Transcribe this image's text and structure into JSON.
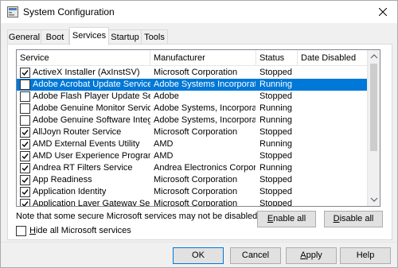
{
  "window": {
    "title": "System Configuration",
    "close_icon": "close-icon",
    "app_icon": "system-config-icon"
  },
  "tabs": [
    {
      "label": "General",
      "active": false
    },
    {
      "label": "Boot",
      "active": false
    },
    {
      "label": "Services",
      "active": true
    },
    {
      "label": "Startup",
      "active": false
    },
    {
      "label": "Tools",
      "active": false
    }
  ],
  "list": {
    "columns": [
      "Service",
      "Manufacturer",
      "Status",
      "Date Disabled"
    ],
    "rows": [
      {
        "checked": true,
        "service": "ActiveX Installer (AxInstSV)",
        "manufacturer": "Microsoft Corporation",
        "status": "Stopped",
        "date_disabled": "",
        "selected": false
      },
      {
        "checked": false,
        "service": "Adobe Acrobat Update Service",
        "manufacturer": "Adobe Systems Incorporated",
        "status": "Running",
        "date_disabled": "",
        "selected": true
      },
      {
        "checked": false,
        "service": "Adobe Flash Player Update Service",
        "manufacturer": "Adobe",
        "status": "Stopped",
        "date_disabled": "",
        "selected": false
      },
      {
        "checked": false,
        "service": "Adobe Genuine Monitor Service",
        "manufacturer": "Adobe Systems, Incorpora...",
        "status": "Running",
        "date_disabled": "",
        "selected": false
      },
      {
        "checked": false,
        "service": "Adobe Genuine Software Integri...",
        "manufacturer": "Adobe Systems, Incorpora...",
        "status": "Running",
        "date_disabled": "",
        "selected": false
      },
      {
        "checked": true,
        "service": "AllJoyn Router Service",
        "manufacturer": "Microsoft Corporation",
        "status": "Stopped",
        "date_disabled": "",
        "selected": false
      },
      {
        "checked": true,
        "service": "AMD External Events Utility",
        "manufacturer": "AMD",
        "status": "Running",
        "date_disabled": "",
        "selected": false
      },
      {
        "checked": true,
        "service": "AMD User Experience Program L...",
        "manufacturer": "AMD",
        "status": "Stopped",
        "date_disabled": "",
        "selected": false
      },
      {
        "checked": true,
        "service": "Andrea RT Filters Service",
        "manufacturer": "Andrea Electronics Corpor...",
        "status": "Running",
        "date_disabled": "",
        "selected": false
      },
      {
        "checked": true,
        "service": "App Readiness",
        "manufacturer": "Microsoft Corporation",
        "status": "Stopped",
        "date_disabled": "",
        "selected": false
      },
      {
        "checked": true,
        "service": "Application Identity",
        "manufacturer": "Microsoft Corporation",
        "status": "Stopped",
        "date_disabled": "",
        "selected": false
      },
      {
        "checked": true,
        "service": "Application Layer Gateway Service",
        "manufacturer": "Microsoft Corporation",
        "status": "Stopped",
        "date_disabled": "",
        "selected": false
      }
    ]
  },
  "note": "Note that some secure Microsoft services may not be disabled.",
  "buttons": {
    "enable_all": {
      "prefix": "",
      "accel": "E",
      "rest": "nable all"
    },
    "disable_all": {
      "prefix": "",
      "accel": "D",
      "rest": "isable all"
    },
    "ok": "OK",
    "cancel": "Cancel",
    "apply": {
      "prefix": "",
      "accel": "A",
      "rest": "pply"
    },
    "help": "Help"
  },
  "hide_ms": {
    "accel": "H",
    "rest": "ide all Microsoft services",
    "checked": false
  },
  "colors": {
    "selection": "#0078d7",
    "window_bg": "#f0f0f0"
  }
}
